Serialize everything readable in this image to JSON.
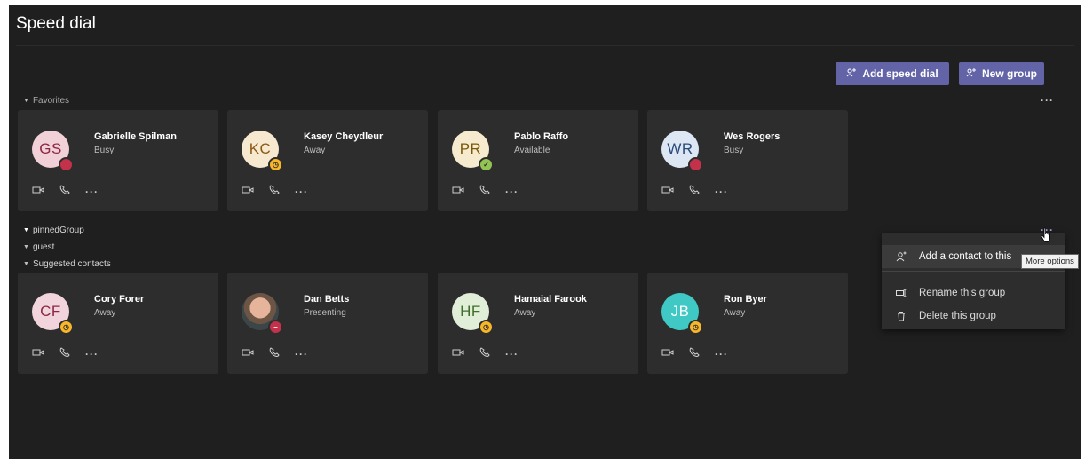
{
  "page": {
    "title": "Speed dial"
  },
  "toolbar": {
    "add_speed_dial": "Add speed dial",
    "new_group": "New group"
  },
  "sections": {
    "favorites": "Favorites",
    "pinned_group": "pinnedGroup",
    "guest": "guest",
    "suggested": "Suggested contacts"
  },
  "favorites": [
    {
      "initials": "GS",
      "name": "Gabrielle Spilman",
      "status": "Busy",
      "avatar_bg": "#f2d0d7",
      "avatar_fg": "#8a2844",
      "presence": "busy"
    },
    {
      "initials": "KC",
      "name": "Kasey Cheydleur",
      "status": "Away",
      "avatar_bg": "#f6e9cf",
      "avatar_fg": "#8a5a14",
      "presence": "away"
    },
    {
      "initials": "PR",
      "name": "Pablo Raffo",
      "status": "Available",
      "avatar_bg": "#f6ebcf",
      "avatar_fg": "#7a5a0a",
      "presence": "available"
    },
    {
      "initials": "WR",
      "name": "Wes Rogers",
      "status": "Busy",
      "avatar_bg": "#dde6f3",
      "avatar_fg": "#2a4a7a",
      "presence": "busy"
    }
  ],
  "suggested": [
    {
      "initials": "CF",
      "name": "Cory Forer",
      "status": "Away",
      "avatar_bg": "#f2d4dc",
      "avatar_fg": "#8a2844",
      "presence": "away"
    },
    {
      "initials": "",
      "name": "Dan Betts",
      "status": "Presenting",
      "avatar_bg": "",
      "avatar_fg": "",
      "presence": "presenting",
      "photo": true
    },
    {
      "initials": "HF",
      "name": "Hamaial Farook",
      "status": "Away",
      "avatar_bg": "#e2efd8",
      "avatar_fg": "#3f6f2a",
      "presence": "away"
    },
    {
      "initials": "JB",
      "name": "Ron Byer",
      "status": "Away",
      "avatar_bg": "#3fc8c4",
      "avatar_fg": "#ffffff",
      "presence": "away"
    }
  ],
  "menu": {
    "add_contact": "Add a contact to this",
    "rename": "Rename this group",
    "delete": "Delete this group"
  },
  "tooltip": "More options",
  "colors": {
    "accent": "#6264a7",
    "busy": "#c4314b",
    "away": "#f8b629",
    "available": "#92c353"
  }
}
